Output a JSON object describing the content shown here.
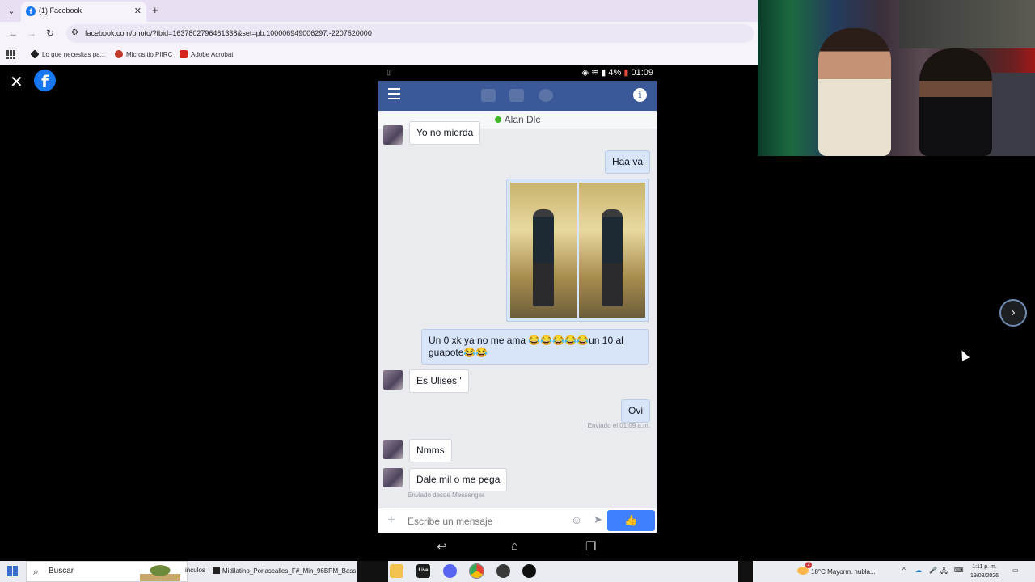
{
  "browser": {
    "tab_title": "(1) Facebook",
    "url": "facebook.com/photo/?fbid=1637802796461338&set=pb.100006949006297.-2207520000",
    "bookmarks": [
      "Lo que necesitas pa...",
      "Micrositio PIIRC",
      "Adobe Acrobat"
    ]
  },
  "phone": {
    "status_time": "01:09",
    "battery": "4%",
    "contact_name": "Alan Dlc",
    "composer_placeholder": "Escribe un mensaje",
    "messages": [
      {
        "dir": "in",
        "text": "Yo no mierda"
      },
      {
        "dir": "out",
        "text": "Haa va"
      },
      {
        "dir": "out",
        "text": "Un 0 xk ya no me ama 😂😂😂😂😂un 10 al guapote😂😂"
      },
      {
        "dir": "in",
        "text": "Es Ulises '"
      },
      {
        "dir": "out",
        "text": "Ovi"
      },
      {
        "dir": "in",
        "text": "Nmms"
      },
      {
        "dir": "in",
        "text": "Dale mil o me pega"
      }
    ],
    "meta_sent_time": "Enviado el 01:09 a.m.",
    "meta_messenger": "Enviado desde Messenger"
  },
  "taskbar": {
    "search_label": "Buscar",
    "partial_label": "inculos",
    "window_title": "Midilatino_Porlascalles_F#_Min_96BPM_Bass 2",
    "weather": "18°C  Mayorm. nubla...",
    "time": "1:11 p. m.",
    "date": "19/08/2026",
    "live_label": "Live",
    "weather_badge": "2"
  },
  "colors": {
    "facebook_blue": "#3b5998",
    "like_button": "#4080ff",
    "online_dot": "#42b72a"
  }
}
